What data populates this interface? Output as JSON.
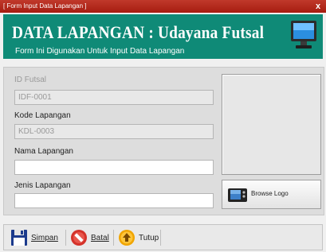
{
  "window": {
    "title": "[ Form Input Data Lapangan ]",
    "close_label": "x"
  },
  "header": {
    "title": "DATA LAPANGAN : Udayana Futsal",
    "subtitle": "Form Ini Digunakan Untuk Input Data Lapangan",
    "background": "#0f8a77"
  },
  "form": {
    "id_futsal": {
      "label": "ID Futsal",
      "value": "IDF-0001"
    },
    "kode_lapangan": {
      "label": "Kode Lapangan",
      "value": "KDL-0003"
    },
    "nama_lapangan": {
      "label": "Nama Lapangan",
      "value": ""
    },
    "jenis_lapangan": {
      "label": "Jenis Lapangan",
      "value": ""
    }
  },
  "logo": {
    "browse_label": "Browse Logo",
    "icon": "tv-icon"
  },
  "toolbar": {
    "save_label": "Simpan",
    "cancel_label": "Batal",
    "close_label": "Tutup"
  },
  "icons": [
    "monitor-icon",
    "floppy-disk-icon",
    "no-entry-icon",
    "exit-arrow-icon"
  ]
}
